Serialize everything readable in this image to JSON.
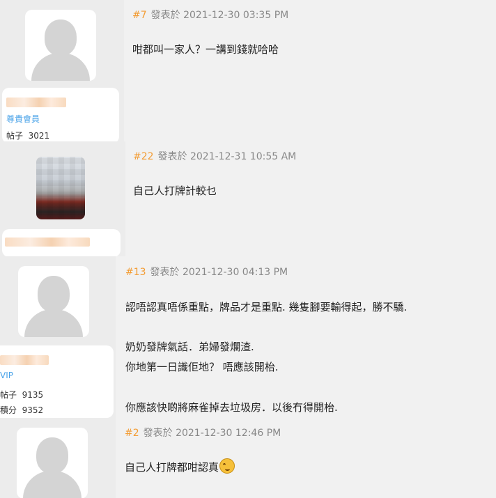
{
  "posts": [
    {
      "number": "#7",
      "meta": "發表於 2021-12-30 03:35 PM",
      "lines": [
        "咁都叫一家人？一講到錢就哈哈"
      ],
      "user": {
        "rank": "尊貴會員",
        "posts_label": "帖子",
        "posts_count": "3021",
        "avatar_icon": "default-avatar-icon"
      }
    },
    {
      "number": "#22",
      "meta": "發表於 2021-12-31 10:55 AM",
      "lines": [
        "自己人打牌計較乜"
      ],
      "user": {
        "avatar_icon": "pixelated-avatar-icon"
      }
    },
    {
      "number": "#13",
      "meta": "發表於 2021-12-30 04:13 PM",
      "lines": [
        "認唔認真唔係重點，牌品才是重點.     幾隻腳要輸得起，勝不驕.",
        "奶奶發牌氣話．弟婦發爛渣.",
        "你地第一日識佢地？ 唔應該開枱.",
        "你應該快啲將麻雀掉去垃圾房．以後冇得開枱."
      ],
      "user": {
        "rank": "VIP",
        "posts_label": "帖子",
        "posts_count": "9135",
        "points_label": "積分",
        "points_count": "9352",
        "avatar_icon": "default-avatar-icon"
      }
    },
    {
      "number": "#2",
      "meta": "發表於 2021-12-30 12:46 PM",
      "lines": [
        "自己人打牌都咁認真"
      ],
      "emoji_icon": "sweat-smile-emoji-icon",
      "user": {
        "avatar_icon": "default-avatar-icon"
      }
    }
  ]
}
